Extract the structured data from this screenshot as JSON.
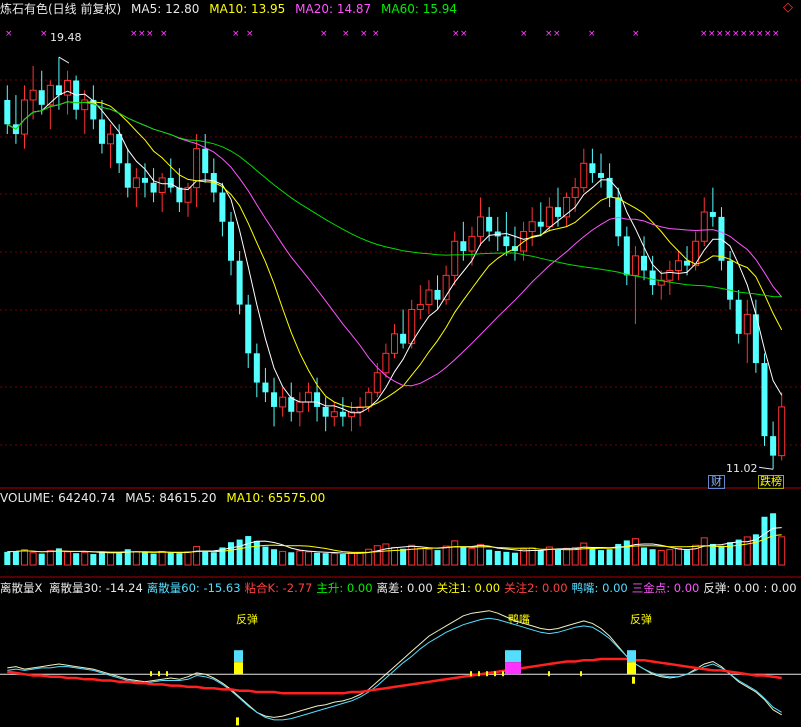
{
  "header": {
    "title": "炼石有色(日线 前复权)",
    "ma5": "MA5: 12.80",
    "ma10": "MA10: 13.95",
    "ma20": "MA20: 14.87",
    "ma60": "MA60: 15.94"
  },
  "volume_header": {
    "volume": "VOLUME: 64240.74",
    "ma5": "MA5: 84615.20",
    "ma10": "MA10: 65575.00"
  },
  "indicator_header": {
    "name": "离散量X",
    "items": [
      {
        "text": "离散量30: -14.24",
        "color": "#e8e8e8"
      },
      {
        "text": "离散量60: -15.63",
        "color": "#55ddff"
      },
      {
        "text": "粘合K: -2.77",
        "color": "#ff4040"
      },
      {
        "text": "主升: 0.00",
        "color": "#00ee00"
      },
      {
        "text": "离差: 0.00",
        "color": "#e8e8e8"
      },
      {
        "text": "关注1: 0.00",
        "color": "#ffff00"
      },
      {
        "text": "关注2: 0.00",
        "color": "#ff4040"
      },
      {
        "text": "鸭嘴: 0.00",
        "color": "#55ddff"
      },
      {
        "text": "三金点: 0.00",
        "color": "#ff55ff"
      },
      {
        "text": "反弹: 0.00",
        "color": "#e8e8e8"
      },
      {
        "text": ": 0.00",
        "color": "#e8e8e8"
      }
    ]
  },
  "annotations": {
    "high_label": "19.48",
    "low_label": "11.02",
    "badge_cai": "财",
    "badge_last": "跌榜",
    "signal_fantan": "反弹",
    "signal_yazui": "鸭嘴"
  },
  "colors": {
    "up": "#ff3232",
    "down": "#54ffff",
    "ma5": "#ffffff",
    "ma10": "#ffff00",
    "ma20": "#ff55ff",
    "ma60": "#00dd00",
    "grid": "#7a0000",
    "divider": "#b00000"
  },
  "chart_data": {
    "type": "candlestick",
    "title": "炼石有色(日线 前复权)",
    "price_range_visible": [
      10.8,
      20.2
    ],
    "high_marked": 19.48,
    "low_marked": 11.02,
    "ma_last": {
      "MA5": 12.8,
      "MA10": 13.95,
      "MA20": 14.87,
      "MA60": 15.94
    },
    "ohlc": [
      [
        18.6,
        18.9,
        17.9,
        18.1
      ],
      [
        18.1,
        18.7,
        17.7,
        17.9
      ],
      [
        17.9,
        18.9,
        17.6,
        18.6
      ],
      [
        18.6,
        19.3,
        18.2,
        18.8
      ],
      [
        18.8,
        19.2,
        18.3,
        18.5
      ],
      [
        18.5,
        19.0,
        18.0,
        18.9
      ],
      [
        18.9,
        19.48,
        18.4,
        18.7
      ],
      [
        18.7,
        19.2,
        18.3,
        19.0
      ],
      [
        19.0,
        19.1,
        18.2,
        18.4
      ],
      [
        18.4,
        18.8,
        17.9,
        18.6
      ],
      [
        18.6,
        18.9,
        18.0,
        18.2
      ],
      [
        18.2,
        18.6,
        17.5,
        17.7
      ],
      [
        17.7,
        18.1,
        17.2,
        17.9
      ],
      [
        17.9,
        18.1,
        17.1,
        17.3
      ],
      [
        17.3,
        17.6,
        16.6,
        16.8
      ],
      [
        16.8,
        17.2,
        16.4,
        17.0
      ],
      [
        17.0,
        17.3,
        16.6,
        16.9
      ],
      [
        16.9,
        17.2,
        16.5,
        16.7
      ],
      [
        16.7,
        17.1,
        16.3,
        17.0
      ],
      [
        17.0,
        17.4,
        16.7,
        16.8
      ],
      [
        16.8,
        17.2,
        16.3,
        16.5
      ],
      [
        16.5,
        16.9,
        16.2,
        16.8
      ],
      [
        16.8,
        17.9,
        16.4,
        17.6
      ],
      [
        17.6,
        17.9,
        16.9,
        17.1
      ],
      [
        17.1,
        17.4,
        16.5,
        16.7
      ],
      [
        16.7,
        16.9,
        15.8,
        16.1
      ],
      [
        16.1,
        16.3,
        15.0,
        15.3
      ],
      [
        15.3,
        15.5,
        14.2,
        14.4
      ],
      [
        14.4,
        14.6,
        13.1,
        13.4
      ],
      [
        13.4,
        13.6,
        12.5,
        12.8
      ],
      [
        12.8,
        13.1,
        12.4,
        12.6
      ],
      [
        12.6,
        12.9,
        11.9,
        12.3
      ],
      [
        12.3,
        12.7,
        12.1,
        12.5
      ],
      [
        12.5,
        12.8,
        12.0,
        12.2
      ],
      [
        12.2,
        12.6,
        11.9,
        12.4
      ],
      [
        12.4,
        12.8,
        12.2,
        12.6
      ],
      [
        12.6,
        12.9,
        12.0,
        12.3
      ],
      [
        12.3,
        12.5,
        11.8,
        12.1
      ],
      [
        12.1,
        12.4,
        11.9,
        12.2
      ],
      [
        12.2,
        12.5,
        11.9,
        12.1
      ],
      [
        12.1,
        12.4,
        11.8,
        12.2
      ],
      [
        12.2,
        12.5,
        11.9,
        12.3
      ],
      [
        12.3,
        12.7,
        12.2,
        12.6
      ],
      [
        12.6,
        13.2,
        12.5,
        13.0
      ],
      [
        13.0,
        13.6,
        12.9,
        13.4
      ],
      [
        13.4,
        14.0,
        13.3,
        13.8
      ],
      [
        13.8,
        14.3,
        13.5,
        13.6
      ],
      [
        13.6,
        14.5,
        13.5,
        14.3
      ],
      [
        14.3,
        14.8,
        14.1,
        14.4
      ],
      [
        14.4,
        14.9,
        14.2,
        14.7
      ],
      [
        14.7,
        15.0,
        14.3,
        14.5
      ],
      [
        14.5,
        15.2,
        14.4,
        15.0
      ],
      [
        15.0,
        15.9,
        14.8,
        15.7
      ],
      [
        15.7,
        16.1,
        15.3,
        15.5
      ],
      [
        15.5,
        16.0,
        15.2,
        15.8
      ],
      [
        15.8,
        16.6,
        15.6,
        16.2
      ],
      [
        16.2,
        16.4,
        15.7,
        15.9
      ],
      [
        15.9,
        16.2,
        15.5,
        15.8
      ],
      [
        15.8,
        16.3,
        15.4,
        15.6
      ],
      [
        15.6,
        16.0,
        15.3,
        15.5
      ],
      [
        15.5,
        16.1,
        15.3,
        15.9
      ],
      [
        15.9,
        16.4,
        15.6,
        16.1
      ],
      [
        16.1,
        16.5,
        15.8,
        16.0
      ],
      [
        16.0,
        16.6,
        15.9,
        16.4
      ],
      [
        16.4,
        16.8,
        16.0,
        16.2
      ],
      [
        16.2,
        16.7,
        16.0,
        16.6
      ],
      [
        16.6,
        17.0,
        16.3,
        16.8
      ],
      [
        16.8,
        17.6,
        16.7,
        17.3
      ],
      [
        17.3,
        17.6,
        16.9,
        17.1
      ],
      [
        17.1,
        17.5,
        16.8,
        17.0
      ],
      [
        17.0,
        17.3,
        16.4,
        16.6
      ],
      [
        16.6,
        16.8,
        15.6,
        15.8
      ],
      [
        15.8,
        16.0,
        14.8,
        15.0
      ],
      [
        15.0,
        15.6,
        14.0,
        15.4
      ],
      [
        15.4,
        15.8,
        14.9,
        15.1
      ],
      [
        15.1,
        15.4,
        14.6,
        14.8
      ],
      [
        14.8,
        15.1,
        14.5,
        14.9
      ],
      [
        14.9,
        15.3,
        14.6,
        15.1
      ],
      [
        15.1,
        15.5,
        14.9,
        15.3
      ],
      [
        15.3,
        15.6,
        15.0,
        15.2
      ],
      [
        15.2,
        15.9,
        15.1,
        15.7
      ],
      [
        15.7,
        16.6,
        15.6,
        16.3
      ],
      [
        16.3,
        16.8,
        16.0,
        16.2
      ],
      [
        16.2,
        16.4,
        15.1,
        15.3
      ],
      [
        15.3,
        15.5,
        14.3,
        14.5
      ],
      [
        14.5,
        14.7,
        13.6,
        13.8
      ],
      [
        13.8,
        14.5,
        13.2,
        14.2
      ],
      [
        14.2,
        14.5,
        13.0,
        13.2
      ],
      [
        13.2,
        13.4,
        11.5,
        11.7
      ],
      [
        11.7,
        12.0,
        11.02,
        11.3
      ],
      [
        11.3,
        12.6,
        11.2,
        12.3
      ]
    ],
    "volume_range": [
      0,
      130000
    ],
    "volume": [
      30000,
      32000,
      35000,
      28000,
      26000,
      33000,
      38000,
      30000,
      27000,
      29000,
      25000,
      31000,
      28000,
      27000,
      36000,
      30000,
      29000,
      26000,
      31000,
      28000,
      27000,
      30000,
      42000,
      33000,
      29000,
      40000,
      52000,
      58000,
      66000,
      55000,
      42000,
      36000,
      31000,
      29000,
      32000,
      30000,
      28000,
      27000,
      26000,
      25000,
      27000,
      29000,
      36000,
      44000,
      48000,
      40000,
      37000,
      45000,
      38000,
      36000,
      34000,
      43000,
      55000,
      41000,
      38000,
      47000,
      35000,
      32000,
      30000,
      28000,
      36000,
      39000,
      33000,
      41000,
      35000,
      38000,
      40000,
      50000,
      37000,
      34000,
      36000,
      48000,
      56000,
      60000,
      40000,
      36000,
      33000,
      35000,
      38000,
      34000,
      45000,
      62000,
      48000,
      44000,
      52000,
      58000,
      64000,
      70000,
      110000,
      118000,
      64240.74
    ],
    "volume_ma": {
      "MA5": 84615.2,
      "MA10": 65575.0
    },
    "indicator": {
      "names": [
        "离散量30",
        "离散量60",
        "粘合K"
      ],
      "last": {
        "离散量30": -14.24,
        "离散量60": -15.63,
        "粘合K": -2.77
      },
      "range": [
        -40,
        60
      ],
      "series_30": [
        5,
        6,
        4,
        5,
        6,
        7,
        8,
        7,
        6,
        5,
        4,
        2,
        0,
        -2,
        -4,
        -5,
        -6,
        -5,
        -4,
        -3,
        -4,
        -2,
        1,
        0,
        -3,
        -7,
        -12,
        -18,
        -24,
        -30,
        -33,
        -34,
        -33,
        -31,
        -29,
        -27,
        -25,
        -24,
        -22,
        -21,
        -19,
        -16,
        -12,
        -6,
        0,
        6,
        12,
        18,
        24,
        30,
        34,
        38,
        42,
        46,
        48,
        49,
        50,
        48,
        45,
        42,
        40,
        38,
        36,
        35,
        36,
        38,
        40,
        42,
        40,
        36,
        30,
        22,
        14,
        8,
        4,
        0,
        -2,
        -3,
        -2,
        0,
        4,
        8,
        10,
        6,
        0,
        -6,
        -10,
        -14,
        -20,
        -28,
        -32
      ],
      "series_60": [
        3,
        4,
        3,
        4,
        5,
        5,
        6,
        6,
        5,
        4,
        3,
        1,
        -1,
        -3,
        -5,
        -6,
        -7,
        -6,
        -5,
        -5,
        -5,
        -4,
        -1,
        -2,
        -4,
        -8,
        -13,
        -19,
        -25,
        -30,
        -34,
        -36,
        -36,
        -35,
        -33,
        -31,
        -29,
        -27,
        -25,
        -23,
        -21,
        -18,
        -14,
        -9,
        -3,
        3,
        9,
        14,
        20,
        25,
        29,
        33,
        36,
        39,
        41,
        43,
        44,
        43,
        41,
        39,
        37,
        35,
        33,
        32,
        33,
        35,
        37,
        38,
        37,
        33,
        28,
        21,
        14,
        8,
        4,
        1,
        -1,
        -2,
        -2,
        0,
        3,
        6,
        8,
        5,
        0,
        -5,
        -9,
        -13,
        -19,
        -26,
        -30
      ],
      "series_k": [
        2,
        1,
        0,
        -1,
        -1,
        -2,
        -2,
        -3,
        -3,
        -4,
        -4,
        -5,
        -5,
        -6,
        -6,
        -7,
        -7,
        -8,
        -8,
        -9,
        -9,
        -10,
        -10,
        -11,
        -11,
        -12,
        -12,
        -13,
        -13,
        -14,
        -14,
        -14,
        -15,
        -15,
        -15,
        -15,
        -15,
        -15,
        -15,
        -15,
        -14,
        -14,
        -13,
        -12,
        -11,
        -10,
        -9,
        -8,
        -7,
        -6,
        -5,
        -4,
        -3,
        -2,
        -1,
        0,
        1,
        2,
        3,
        4,
        5,
        6,
        7,
        8,
        9,
        10,
        10,
        11,
        11,
        12,
        12,
        12,
        12,
        11,
        11,
        10,
        9,
        8,
        7,
        6,
        5,
        4,
        3,
        3,
        2,
        1,
        0,
        -1,
        -1,
        -2,
        -3
      ],
      "signals": [
        "反弹",
        "鸭嘴",
        "反弹"
      ]
    }
  }
}
